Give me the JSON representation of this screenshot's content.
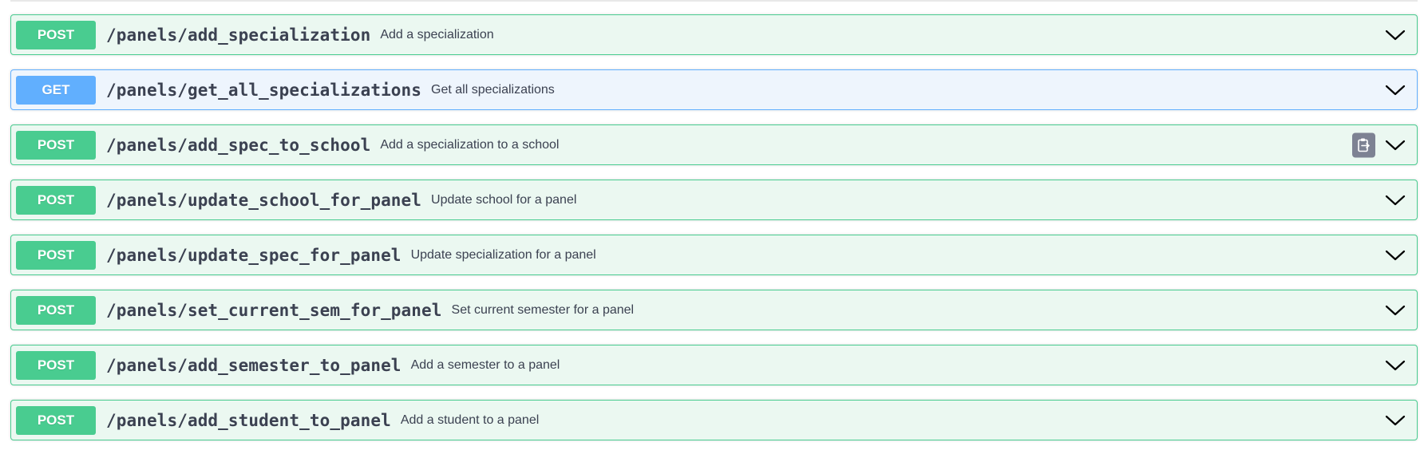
{
  "colors": {
    "post_accent": "#49cc90",
    "post_background": "#ebf8f1",
    "get_accent": "#61affe",
    "get_background": "#eef5fd",
    "text": "#3b4151",
    "copy_button": "#7d8293"
  },
  "operations": [
    {
      "method": "POST",
      "path": "/panels/add_specialization",
      "summary": "Add a specialization",
      "show_copy": false,
      "icon": "chevron-down-icon"
    },
    {
      "method": "GET",
      "path": "/panels/get_all_specializations",
      "summary": "Get all specializations",
      "show_copy": false,
      "icon": "chevron-down-icon"
    },
    {
      "method": "POST",
      "path": "/panels/add_spec_to_school",
      "summary": "Add a specialization to a school",
      "show_copy": true,
      "icon": "chevron-down-icon"
    },
    {
      "method": "POST",
      "path": "/panels/update_school_for_panel",
      "summary": "Update school for a panel",
      "show_copy": false,
      "icon": "chevron-down-icon"
    },
    {
      "method": "POST",
      "path": "/panels/update_spec_for_panel",
      "summary": "Update specialization for a panel",
      "show_copy": false,
      "icon": "chevron-down-icon"
    },
    {
      "method": "POST",
      "path": "/panels/set_current_sem_for_panel",
      "summary": "Set current semester for a panel",
      "show_copy": false,
      "icon": "chevron-down-icon"
    },
    {
      "method": "POST",
      "path": "/panels/add_semester_to_panel",
      "summary": "Add a semester to a panel",
      "show_copy": false,
      "icon": "chevron-down-icon"
    },
    {
      "method": "POST",
      "path": "/panels/add_student_to_panel",
      "summary": "Add a student to a panel",
      "show_copy": false,
      "icon": "chevron-down-icon"
    }
  ]
}
